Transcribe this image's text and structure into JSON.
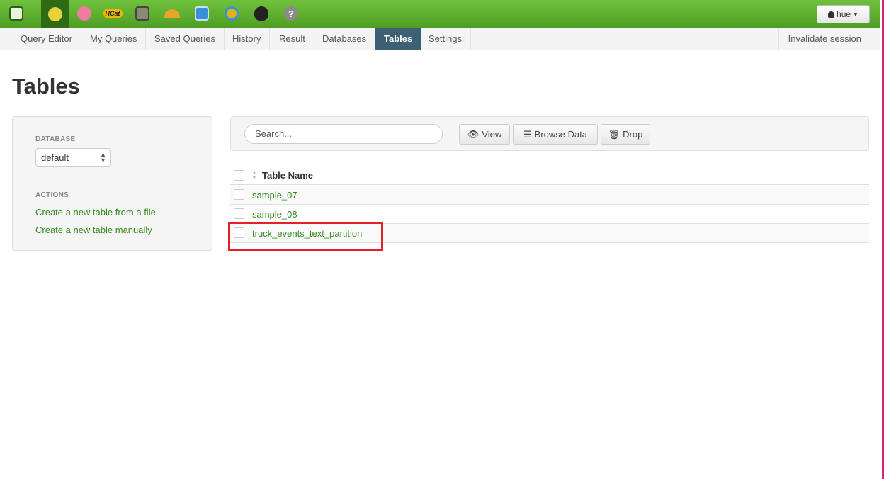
{
  "topbar": {
    "user_label": "hue",
    "apps": [
      {
        "name": "hue-logo-icon",
        "color": "#3b7a1c"
      },
      {
        "name": "beeswax-icon",
        "color": "#e8d13a"
      },
      {
        "name": "pig-icon",
        "color": "#f07aa0"
      },
      {
        "name": "hcat-icon",
        "label": "HCat",
        "color": "#f2b800"
      },
      {
        "name": "file-browser-icon",
        "color": "#6b6b5b"
      },
      {
        "name": "job-designer-icon",
        "color": "#e7a42a"
      },
      {
        "name": "oozie-icon",
        "color": "#3b8fd6"
      },
      {
        "name": "job-browser-icon",
        "color": "#e0b21a"
      },
      {
        "name": "user-admin-icon",
        "color": "#222222"
      },
      {
        "name": "help-icon",
        "color": "#8a8a8a"
      }
    ]
  },
  "subnav": {
    "items": [
      "Query Editor",
      "My Queries",
      "Saved Queries",
      "History",
      "Result",
      "Databases",
      "Tables",
      "Settings"
    ],
    "active": "Tables",
    "invalidate": "Invalidate session"
  },
  "page": {
    "title": "Tables"
  },
  "sidebar": {
    "database_header": "DATABASE",
    "database_value": "default",
    "actions_header": "ACTIONS",
    "actions": [
      "Create a new table from a file",
      "Create a new table manually"
    ]
  },
  "toolbar": {
    "search_placeholder": "Search...",
    "view_label": "View",
    "browse_label": "Browse Data",
    "drop_label": "Drop"
  },
  "table": {
    "column_header": "Table Name",
    "rows": [
      "sample_07",
      "sample_08",
      "truck_events_text_partition"
    ],
    "highlighted_row": "truck_events_text_partition"
  },
  "colors": {
    "link": "#338a1d",
    "accent": "#3e6074",
    "highlight": "#e6202b"
  }
}
